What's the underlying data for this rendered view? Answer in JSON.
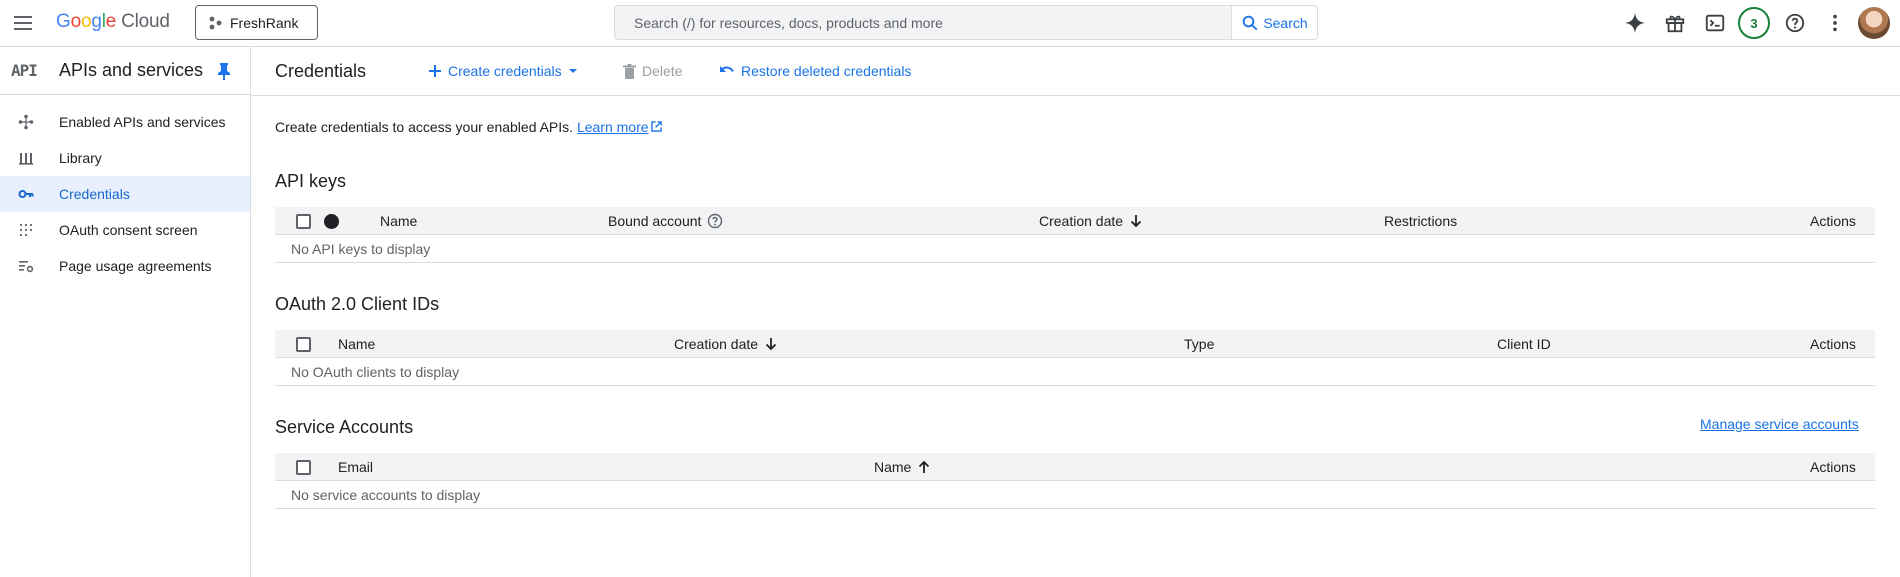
{
  "header": {
    "brand": {
      "g1": "G",
      "g2": "o",
      "g3": "o",
      "g4": "g",
      "g5": "l",
      "g6": "e",
      "cloud": "Cloud"
    },
    "project": "FreshRank",
    "search_placeholder": "Search (/) for resources, docs, products and more",
    "search_button": "Search",
    "notification_count": "3",
    "icons": [
      "menu-icon",
      "gemini-icon",
      "gift-icon",
      "cloud-shell-icon",
      "help-icon",
      "more-vert-icon"
    ]
  },
  "sidebar": {
    "mark": "API",
    "title": "APIs and services",
    "items": [
      {
        "label": "Enabled APIs and services",
        "icon": "hub-icon"
      },
      {
        "label": "Library",
        "icon": "library-icon"
      },
      {
        "label": "Credentials",
        "icon": "key-icon",
        "active": true
      },
      {
        "label": "OAuth consent screen",
        "icon": "consent-icon"
      },
      {
        "label": "Page usage agreements",
        "icon": "settings-list-icon"
      }
    ]
  },
  "toolbar": {
    "title": "Credentials",
    "create": "Create credentials",
    "delete": "Delete",
    "restore": "Restore deleted credentials"
  },
  "intro": {
    "text": "Create credentials to access your enabled APIs.",
    "link": "Learn more"
  },
  "api_keys": {
    "title": "API keys",
    "columns": [
      "Name",
      "Bound account",
      "Creation date",
      "Restrictions",
      "Actions"
    ],
    "empty": "No API keys to display"
  },
  "oauth": {
    "title": "OAuth 2.0 Client IDs",
    "columns": [
      "Name",
      "Creation date",
      "Type",
      "Client ID",
      "Actions"
    ],
    "empty": "No OAuth clients to display"
  },
  "service_accounts": {
    "title": "Service Accounts",
    "manage_link": "Manage service accounts",
    "columns": [
      "Email",
      "Name",
      "Actions"
    ],
    "empty": "No service accounts to display"
  },
  "colors": {
    "accent": "#1a73e8",
    "active_bg": "#e8f0fe",
    "border": "#dadce0",
    "header_bg": "#f1f3f4"
  }
}
